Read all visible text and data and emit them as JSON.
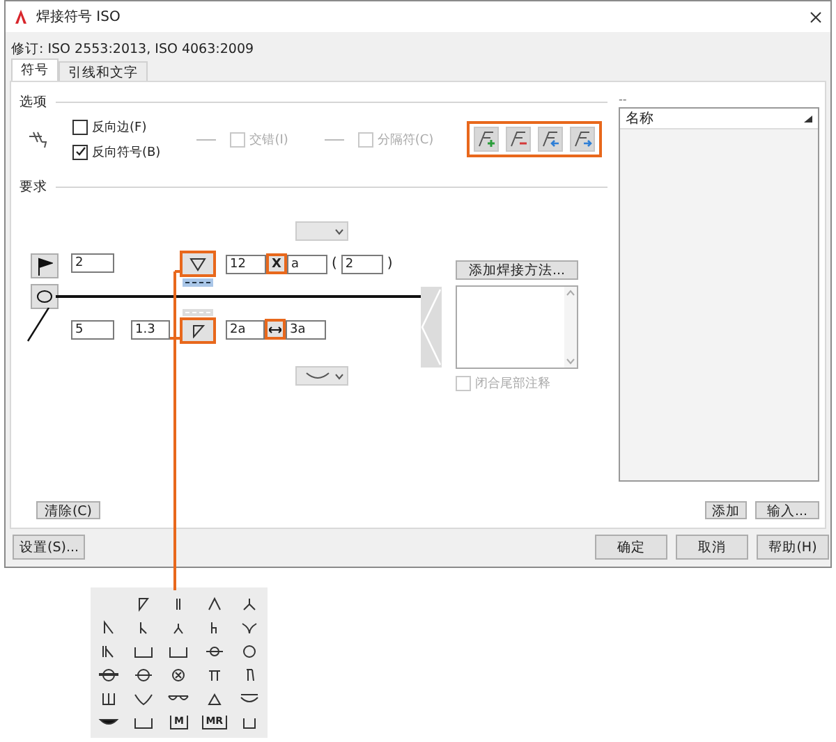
{
  "window": {
    "title": "焊接符号 ISO"
  },
  "revision": "修订: ISO 2553:2013, ISO 4063:2009",
  "tabs": [
    {
      "label": "符号",
      "selected": true
    },
    {
      "label": "引线和文字",
      "selected": false
    }
  ],
  "options": {
    "title": "选项",
    "checkboxes": [
      {
        "label": "反向边(F)",
        "checked": false,
        "disabled": false
      },
      {
        "label": "反向符号(B)",
        "checked": true,
        "disabled": false
      },
      {
        "label": "交错(I)",
        "checked": false,
        "disabled": true
      },
      {
        "label": "分隔符(C)",
        "checked": false,
        "disabled": true
      }
    ],
    "tools_highlighted": true
  },
  "requirements": {
    "title": "要求",
    "upper": {
      "field_1": "2",
      "symbol_highlighted": true,
      "field_2": "12",
      "x_button": {
        "label": "X",
        "highlighted": true
      },
      "field_3": "a",
      "open_paren": "(",
      "field_4": "2",
      "close_paren": ")"
    },
    "lower": {
      "field_1": "5",
      "field_2": "1.3",
      "symbol_highlighted": true,
      "field_3": "2a",
      "arrow_button_highlighted": true,
      "field_4": "3a"
    },
    "add_method_button": "添加焊接方法...",
    "close_tail": {
      "label": "闭合尾部注释",
      "checked": false,
      "disabled": true
    },
    "clear_button": "清除(C)"
  },
  "side_panel": {
    "caption": "--",
    "column": "名称",
    "buttons": [
      "添加",
      "输入..."
    ]
  },
  "footer": {
    "settings_button": "设置(S)...",
    "buttons": [
      "确定",
      "取消",
      "帮助(H)"
    ]
  },
  "palette": [
    [
      {
        "kind": "empty"
      },
      {
        "kind": "icon"
      },
      {
        "kind": "icon"
      },
      {
        "kind": "icon"
      },
      {
        "kind": "icon"
      }
    ],
    [
      {
        "kind": "icon"
      },
      {
        "kind": "icon"
      },
      {
        "kind": "icon"
      },
      {
        "kind": "icon"
      },
      {
        "kind": "icon"
      }
    ],
    [
      {
        "kind": "icon"
      },
      {
        "kind": "icon"
      },
      {
        "kind": "icon"
      },
      {
        "kind": "icon"
      },
      {
        "kind": "icon"
      }
    ],
    [
      {
        "kind": "icon"
      },
      {
        "kind": "icon"
      },
      {
        "kind": "icon"
      },
      {
        "kind": "icon"
      },
      {
        "kind": "icon"
      }
    ],
    [
      {
        "kind": "icon"
      },
      {
        "kind": "icon"
      },
      {
        "kind": "icon"
      },
      {
        "kind": "icon"
      },
      {
        "kind": "icon"
      }
    ],
    [
      {
        "kind": "icon"
      },
      {
        "kind": "icon"
      },
      {
        "kind": "label",
        "label": "M"
      },
      {
        "kind": "label",
        "label": "MR"
      },
      {
        "kind": "icon"
      }
    ]
  ]
}
